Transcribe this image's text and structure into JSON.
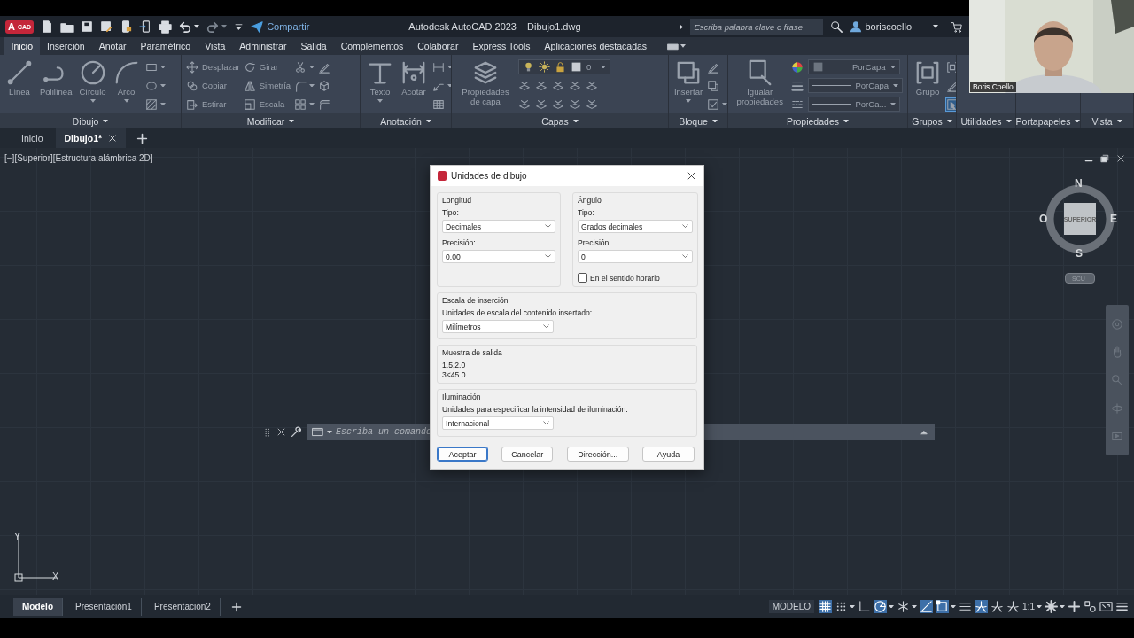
{
  "title_bar": {
    "logo": {
      "letter": "A",
      "text": "CAD"
    },
    "share": "Compartir",
    "app_title": "Autodesk AutoCAD 2023",
    "file_name": "Dibujo1.dwg",
    "search": {
      "placeholder": "Escriba palabra clave o frase"
    },
    "user": "boriscoello"
  },
  "ribbon_tabs": [
    {
      "label": "Inicio",
      "selected": true
    },
    {
      "label": "Inserción",
      "selected": false
    },
    {
      "label": "Anotar",
      "selected": false
    },
    {
      "label": "Paramétrico",
      "selected": false
    },
    {
      "label": "Vista",
      "selected": false
    },
    {
      "label": "Administrar",
      "selected": false
    },
    {
      "label": "Salida",
      "selected": false
    },
    {
      "label": "Complementos",
      "selected": false
    },
    {
      "label": "Colaborar",
      "selected": false
    },
    {
      "label": "Express Tools",
      "selected": false
    },
    {
      "label": "Aplicaciones destacadas",
      "selected": false
    }
  ],
  "ribbon": {
    "disabled": true,
    "panels": [
      {
        "title": "Dibujo",
        "columns": [
          {
            "kind": "large",
            "label": "Línea",
            "menu": false
          },
          {
            "kind": "large",
            "label": "Polilínea",
            "menu": false
          },
          {
            "kind": "large",
            "label": "Círculo",
            "menu": true
          },
          {
            "kind": "large",
            "label": "Arco",
            "menu": true
          },
          {
            "kind": "stack",
            "rows": [
              [
                {
                  "kind": "icon",
                  "menu": true
                }
              ],
              [
                {
                  "kind": "icon",
                  "menu": true
                }
              ],
              [
                {
                  "kind": "icon",
                  "menu": true
                }
              ]
            ]
          }
        ]
      },
      {
        "title": "Modificar",
        "columns": [
          {
            "kind": "stack",
            "rows": [
              [
                {
                  "kind": "small",
                  "label": "Desplazar"
                }
              ],
              [
                {
                  "kind": "small",
                  "label": "Copiar"
                }
              ],
              [
                {
                  "kind": "small",
                  "label": "Estirar"
                }
              ]
            ]
          },
          {
            "kind": "stack",
            "rows": [
              [
                {
                  "kind": "small",
                  "label": "Girar"
                }
              ],
              [
                {
                  "kind": "small",
                  "label": "Simetría"
                }
              ],
              [
                {
                  "kind": "small",
                  "label": "Escala"
                }
              ]
            ]
          },
          {
            "kind": "stack",
            "rows": [
              [
                {
                  "kind": "icon",
                  "menu": true
                }
              ],
              [
                {
                  "kind": "icon",
                  "menu": true
                }
              ],
              [
                {
                  "kind": "icon",
                  "menu": true
                }
              ]
            ]
          },
          {
            "kind": "stack",
            "rows": [
              [
                {
                  "kind": "icon",
                  "menu": false
                }
              ],
              [
                {
                  "kind": "icon",
                  "menu": false
                }
              ],
              [
                {
                  "kind": "icon",
                  "menu": false
                }
              ]
            ]
          }
        ]
      },
      {
        "title": "Anotación",
        "columns": [
          {
            "kind": "large",
            "label": "Texto",
            "menu": true
          },
          {
            "kind": "large",
            "label": "Acotar",
            "menu": false
          },
          {
            "kind": "stack",
            "rows": [
              [
                {
                  "kind": "icon",
                  "menu": true
                }
              ],
              [
                {
                  "kind": "icon",
                  "menu": true
                }
              ],
              [
                {
                  "kind": "icon",
                  "menu": false
                }
              ]
            ]
          }
        ]
      },
      {
        "title": "Capas",
        "columns": [
          {
            "kind": "large",
            "label": "Propiedades de capa",
            "menu": false
          },
          {
            "kind": "stack",
            "rows": [
              [
                {
                  "kind": "dropdown",
                  "value": "0"
                }
              ],
              [
                {
                  "kind": "icon",
                  "menu": false
                },
                {
                  "kind": "icon",
                  "menu": false
                },
                {
                  "kind": "icon",
                  "menu": false
                },
                {
                  "kind": "icon",
                  "menu": false
                },
                {
                  "kind": "icon",
                  "menu": false
                }
              ],
              [
                {
                  "kind": "icon",
                  "menu": false
                },
                {
                  "kind": "icon",
                  "menu": false
                },
                {
                  "kind": "icon",
                  "menu": false
                },
                {
                  "kind": "icon",
                  "menu": false
                },
                {
                  "kind": "icon",
                  "menu": false
                }
              ]
            ]
          }
        ]
      },
      {
        "title": "Bloque",
        "columns": [
          {
            "kind": "large",
            "label": "Insertar",
            "menu": true
          },
          {
            "kind": "stack",
            "rows": [
              [
                {
                  "kind": "icon",
                  "menu": false
                }
              ],
              [
                {
                  "kind": "icon",
                  "menu": false
                }
              ],
              [
                {
                  "kind": "icon",
                  "menu": true
                }
              ]
            ]
          }
        ]
      },
      {
        "title": "Propiedades",
        "columns": [
          {
            "kind": "large",
            "label": "Igualar propiedades",
            "menu": false
          },
          {
            "kind": "stack",
            "rows": [
              [
                {
                  "kind": "icon",
                  "menu": false
                },
                {
                  "kind": "dropdown",
                  "value": "PorCapa"
                }
              ],
              [
                {
                  "kind": "icon",
                  "menu": false
                },
                {
                  "kind": "dropdown",
                  "value": "PorCapa"
                }
              ],
              [
                {
                  "kind": "icon",
                  "menu": false
                },
                {
                  "kind": "dropdown",
                  "value": "PorCa..."
                }
              ]
            ]
          }
        ]
      },
      {
        "title": "Grupos",
        "columns": [
          {
            "kind": "large",
            "label": "Grupo",
            "menu": false
          },
          {
            "kind": "stack",
            "rows": [
              [
                {
                  "kind": "icon",
                  "menu": false,
                  "on": false
                }
              ],
              [
                {
                  "kind": "icon",
                  "menu": false,
                  "on": false
                }
              ],
              [
                {
                  "kind": "icon",
                  "menu": false,
                  "on": true
                }
              ]
            ]
          }
        ]
      },
      {
        "title": "Utilidades"
      },
      {
        "title": "Portapapeles"
      },
      {
        "title": "Vista"
      }
    ]
  },
  "document_tabs": [
    {
      "label": "Inicio",
      "selected": false,
      "closable": false
    },
    {
      "label": "Dibujo1*",
      "selected": true,
      "closable": true
    }
  ],
  "viewport": {
    "label": "[−][Superior][Estructura alámbrica 2D]",
    "view_cube": {
      "top": "SUPERIOR",
      "north": "N",
      "south": "S",
      "east": "E",
      "west": "O",
      "ucs": "SCU"
    },
    "ucs_icon": {
      "x": "X",
      "y": "Y"
    },
    "command_line": {
      "placeholder": "Escriba un comando"
    }
  },
  "dialog": {
    "title": "Unidades de dibujo",
    "length": {
      "heading": "Longitud",
      "type_label": "Tipo:",
      "type_value": "Decimales",
      "precision_label": "Precisión:",
      "precision_value": "0.00"
    },
    "angle": {
      "heading": "Ángulo",
      "type_label": "Tipo:",
      "type_value": "Grados decimales",
      "precision_label": "Precisión:",
      "precision_value": "0",
      "clockwise": {
        "label": "En el sentido horario",
        "checked": false
      }
    },
    "insertion_scale": {
      "heading": "Escala de inserción",
      "label": "Unidades de escala del contenido insertado:",
      "value": "Milímetros"
    },
    "sample_output": {
      "heading": "Muestra de salida",
      "lines": [
        "1.5,2.0",
        "3<45.0"
      ]
    },
    "lighting": {
      "heading": "Iluminación",
      "label": "Unidades para especificar la intensidad de iluminación:",
      "value": "Internacional"
    },
    "buttons": [
      {
        "label": "Aceptar",
        "default": true
      },
      {
        "label": "Cancelar",
        "default": false
      },
      {
        "label": "Dirección...",
        "default": false
      },
      {
        "label": "Ayuda",
        "default": false
      }
    ]
  },
  "layout_tabs": [
    {
      "label": "Modelo",
      "selected": true
    },
    {
      "label": "Presentación1",
      "selected": false
    },
    {
      "label": "Presentación2",
      "selected": false
    }
  ],
  "status_bar": {
    "space": "MODELO",
    "tools": [
      {
        "on": true,
        "menu": false
      },
      {
        "on": false,
        "menu": true
      },
      {
        "on": false,
        "menu": false
      },
      {
        "on": true,
        "menu": true
      },
      {
        "on": false,
        "menu": true
      },
      {
        "on": true,
        "menu": false
      },
      {
        "on": true,
        "menu": true
      },
      {
        "on": false,
        "menu": false
      },
      {
        "on": true,
        "menu": false
      },
      {
        "on": false,
        "menu": false
      },
      {
        "on": false,
        "menu": false
      }
    ],
    "scale": "1:1",
    "tools_right": [
      {
        "on": false,
        "menu": true
      },
      {
        "on": false,
        "menu": false
      },
      {
        "on": false,
        "menu": false
      },
      {
        "on": false,
        "menu": false
      },
      {
        "on": false,
        "menu": false
      }
    ]
  },
  "webcam": {
    "name": "Boris Coello"
  }
}
